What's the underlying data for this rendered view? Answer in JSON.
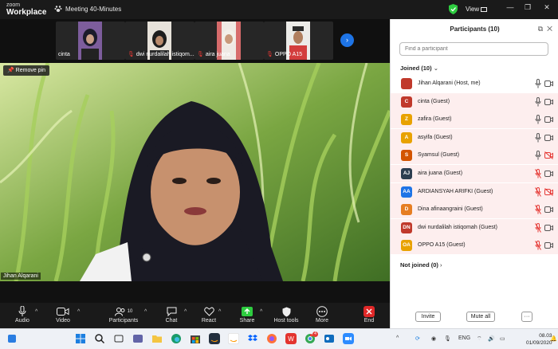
{
  "app": {
    "brand_top": "zoom",
    "brand_main": "Workplace",
    "meeting_title": "Meeting 40-Minutes",
    "view_label": "View"
  },
  "thumbnails": [
    {
      "name": "cinta",
      "muted": false
    },
    {
      "name": "dwi nurdalilah istiqom...",
      "muted": true
    },
    {
      "name": "aira juana",
      "muted": true
    },
    {
      "name": "OPPO A15",
      "muted": true
    }
  ],
  "video": {
    "remove_pin_label": "Remove pin",
    "speaker_name": "Jihan Alqarani"
  },
  "toolbar": {
    "audio": "Audio",
    "video": "Video",
    "participants": "Participants",
    "participants_count": "10",
    "chat": "Chat",
    "react": "React",
    "share": "Share",
    "host_tools": "Host tools",
    "more": "More",
    "end": "End"
  },
  "panel": {
    "title": "Participants (10)",
    "search_placeholder": "Find a participant",
    "joined_label": "Joined (10)",
    "not_joined_label": "Not joined (0)",
    "invite_label": "Invite",
    "mute_all_label": "Mute all",
    "more_label": "···",
    "participants": [
      {
        "initials": "",
        "name": "Jihan Alqarani (Host, me)",
        "color": "#c0392b",
        "mic": "on",
        "cam": "on",
        "highlight": false
      },
      {
        "initials": "C",
        "name": "cinta (Guest)",
        "color": "#c0392b",
        "mic": "on",
        "cam": "on",
        "highlight": true
      },
      {
        "initials": "Z",
        "name": "zafira (Guest)",
        "color": "#e8a200",
        "mic": "on",
        "cam": "on",
        "highlight": true
      },
      {
        "initials": "A",
        "name": "asyifa (Guest)",
        "color": "#e8a200",
        "mic": "on",
        "cam": "on",
        "highlight": true
      },
      {
        "initials": "S",
        "name": "Syamsul (Guest)",
        "color": "#d35400",
        "mic": "on",
        "cam": "off",
        "highlight": true
      },
      {
        "initials": "AJ",
        "name": "aira juana (Guest)",
        "color": "#2c3e50",
        "mic": "off",
        "cam": "on",
        "highlight": true
      },
      {
        "initials": "AA",
        "name": "ARDIANSYAH ARIFKI (Guest)",
        "color": "#1e74e6",
        "mic": "off",
        "cam": "off",
        "highlight": true
      },
      {
        "initials": "D",
        "name": "Dina afinaangraini (Guest)",
        "color": "#e67e22",
        "mic": "off",
        "cam": "on",
        "highlight": true
      },
      {
        "initials": "DN",
        "name": "dwi nurdalilah istiqomah (Guest)",
        "color": "#c0392b",
        "mic": "off",
        "cam": "on",
        "highlight": true
      },
      {
        "initials": "OA",
        "name": "OPPO A15 (Guest)",
        "color": "#e8a200",
        "mic": "off",
        "cam": "on",
        "highlight": true
      }
    ]
  },
  "taskbar": {
    "ime": "ENG",
    "time": "08.03",
    "date": "01/09/2020",
    "badge_count": "4"
  }
}
